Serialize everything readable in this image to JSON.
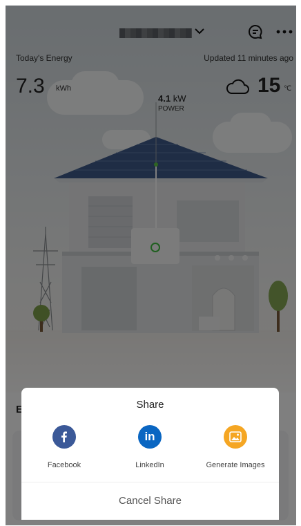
{
  "header": {
    "title_obscured": true,
    "chat_icon": "chat-bubble-icon",
    "more_icon": "more-horizontal-icon"
  },
  "stats": {
    "today_label": "Today's Energy",
    "today_value": "7.3",
    "today_unit": "kWh",
    "updated_text": "Updated 11 minutes ago",
    "weather_icon": "cloud-icon",
    "temperature": "15",
    "temperature_unit": "℃",
    "power_value": "4.1",
    "power_unit": "kW",
    "power_label": "POWER"
  },
  "section": {
    "title_partial": "E"
  },
  "share_sheet": {
    "title": "Share",
    "options": [
      {
        "label": "Facebook",
        "icon": "facebook-icon",
        "color": "#3b5998"
      },
      {
        "label": "LinkedIn",
        "icon": "linkedin-icon",
        "color": "#0a66c2"
      },
      {
        "label": "Generate Images",
        "icon": "image-icon",
        "color": "#f5a623"
      }
    ],
    "cancel_label": "Cancel Share"
  }
}
